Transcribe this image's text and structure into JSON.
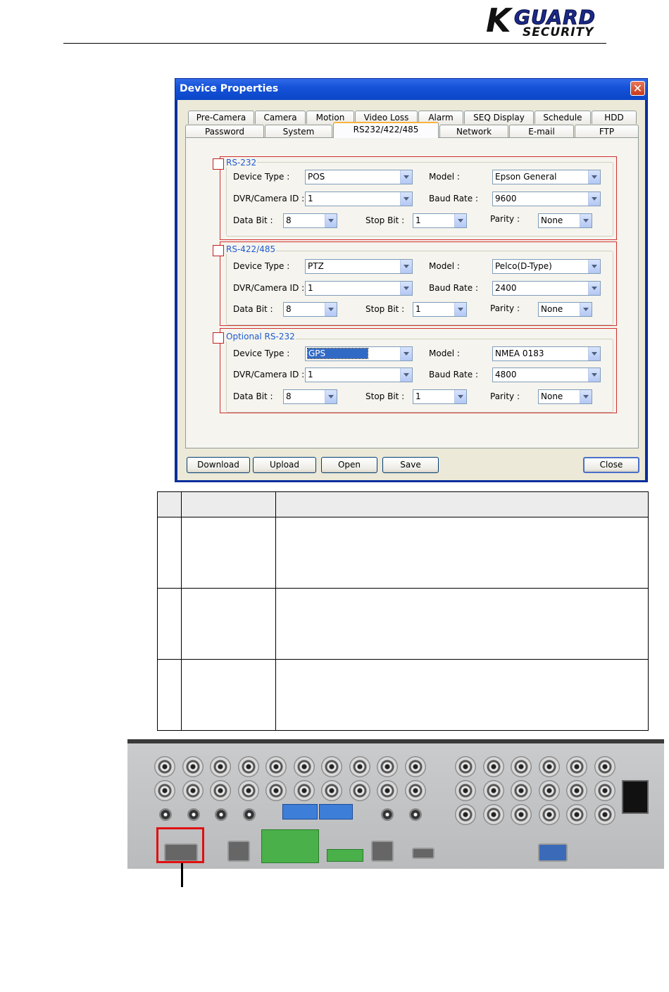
{
  "brand": {
    "letter": "K",
    "name": "GUARD",
    "tagline": "SECURITY"
  },
  "dialog": {
    "title": "Device Properties",
    "close_glyph": "✕",
    "tabs_row1": [
      "Pre-Camera",
      "Camera",
      "Motion",
      "Video Loss",
      "Alarm",
      "SEQ Display",
      "Schedule",
      "HDD"
    ],
    "tabs_row2": [
      "Password",
      "System",
      "RS232/422/485",
      "Network",
      "E-mail",
      "FTP"
    ],
    "active_tab": "RS232/422/485",
    "labels": {
      "device_type": "Device Type :",
      "model": "Model :",
      "dvr_camera_id": "DVR/Camera ID :",
      "baud_rate": "Baud Rate :",
      "data_bit": "Data Bit :",
      "stop_bit": "Stop Bit :",
      "parity": "Parity :"
    },
    "groups": [
      {
        "title": "RS-232",
        "device_type": "POS",
        "model": "Epson General",
        "dvr_camera_id": "1",
        "baud_rate": "9600",
        "data_bit": "8",
        "stop_bit": "1",
        "parity": "None"
      },
      {
        "title": "RS-422/485",
        "device_type": "PTZ",
        "model": "Pelco(D-Type)",
        "dvr_camera_id": "1",
        "baud_rate": "2400",
        "data_bit": "8",
        "stop_bit": "1",
        "parity": "None"
      },
      {
        "title": "Optional RS-232",
        "device_type": "GPS",
        "model": "NMEA 0183",
        "dvr_camera_id": "1",
        "baud_rate": "4800",
        "data_bit": "8",
        "stop_bit": "1",
        "parity": "None"
      }
    ],
    "buttons": {
      "download": "Download",
      "upload": "Upload",
      "open": "Open",
      "save": "Save",
      "close": "Close"
    }
  }
}
